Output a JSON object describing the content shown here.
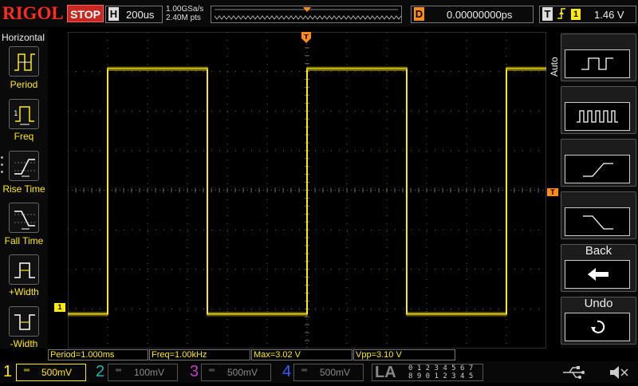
{
  "header": {
    "logo": "RIGOL",
    "run_state": "STOP",
    "horizontal": {
      "label": "H",
      "scale": "200us"
    },
    "sample_rate": "1.00GSa/s",
    "memory_depth": "2.40M pts",
    "delay": {
      "label": "D",
      "value": "0.00000000ps"
    },
    "trigger": {
      "label": "T",
      "edge_icon": "rising-edge-icon",
      "source": "1",
      "level": "1.46 V"
    }
  },
  "left_menu": {
    "title": "Horizontal",
    "items": [
      {
        "label": "Period",
        "icon": "period-icon"
      },
      {
        "label": "Freq",
        "icon": "frequency-icon"
      },
      {
        "label": "Rise Time",
        "icon": "rise-time-icon"
      },
      {
        "label": "Fall Time",
        "icon": "fall-time-icon"
      },
      {
        "label": "+Width",
        "icon": "positive-width-icon"
      },
      {
        "label": "-Width",
        "icon": "negative-width-icon"
      }
    ]
  },
  "right_menu": {
    "vertical_label": "Auto",
    "items": [
      {
        "icon": "single-period-icon"
      },
      {
        "icon": "multi-period-icon"
      },
      {
        "icon": "rising-edge-zoom-icon"
      },
      {
        "icon": "falling-edge-zoom-icon"
      },
      {
        "label": "Back",
        "icon": "back-arrow-icon"
      },
      {
        "label": "Undo",
        "icon": "undo-icon"
      }
    ]
  },
  "markers": {
    "channel1": "1",
    "trigger_position": "T",
    "trigger_level": "T"
  },
  "measurements": [
    "Period=1.000ms",
    "Freq=1.00kHz",
    "Max=3.02 V",
    "Vpp=3.10 V"
  ],
  "channels": [
    {
      "number": "1",
      "scale": "500mV",
      "color": "#ffea00",
      "active": true
    },
    {
      "number": "2",
      "scale": "100mV",
      "color": "#19b5b5",
      "active": false
    },
    {
      "number": "3",
      "scale": "500mV",
      "color": "#c040c0",
      "active": false
    },
    {
      "number": "4",
      "scale": "500mV",
      "color": "#3060ff",
      "active": false
    }
  ],
  "logic_analyzer": {
    "label": "LA",
    "row1": "0 1 2 3  4 5 6 7",
    "row2": "8 9 0 1  2 3 4 5"
  },
  "status_icons": [
    "usb-icon",
    "speaker-muted-icon"
  ],
  "waveform": {
    "color": "#ffea00",
    "type": "square",
    "period_ms": 1.0,
    "high_V": 3.0,
    "low_V": -0.1
  }
}
